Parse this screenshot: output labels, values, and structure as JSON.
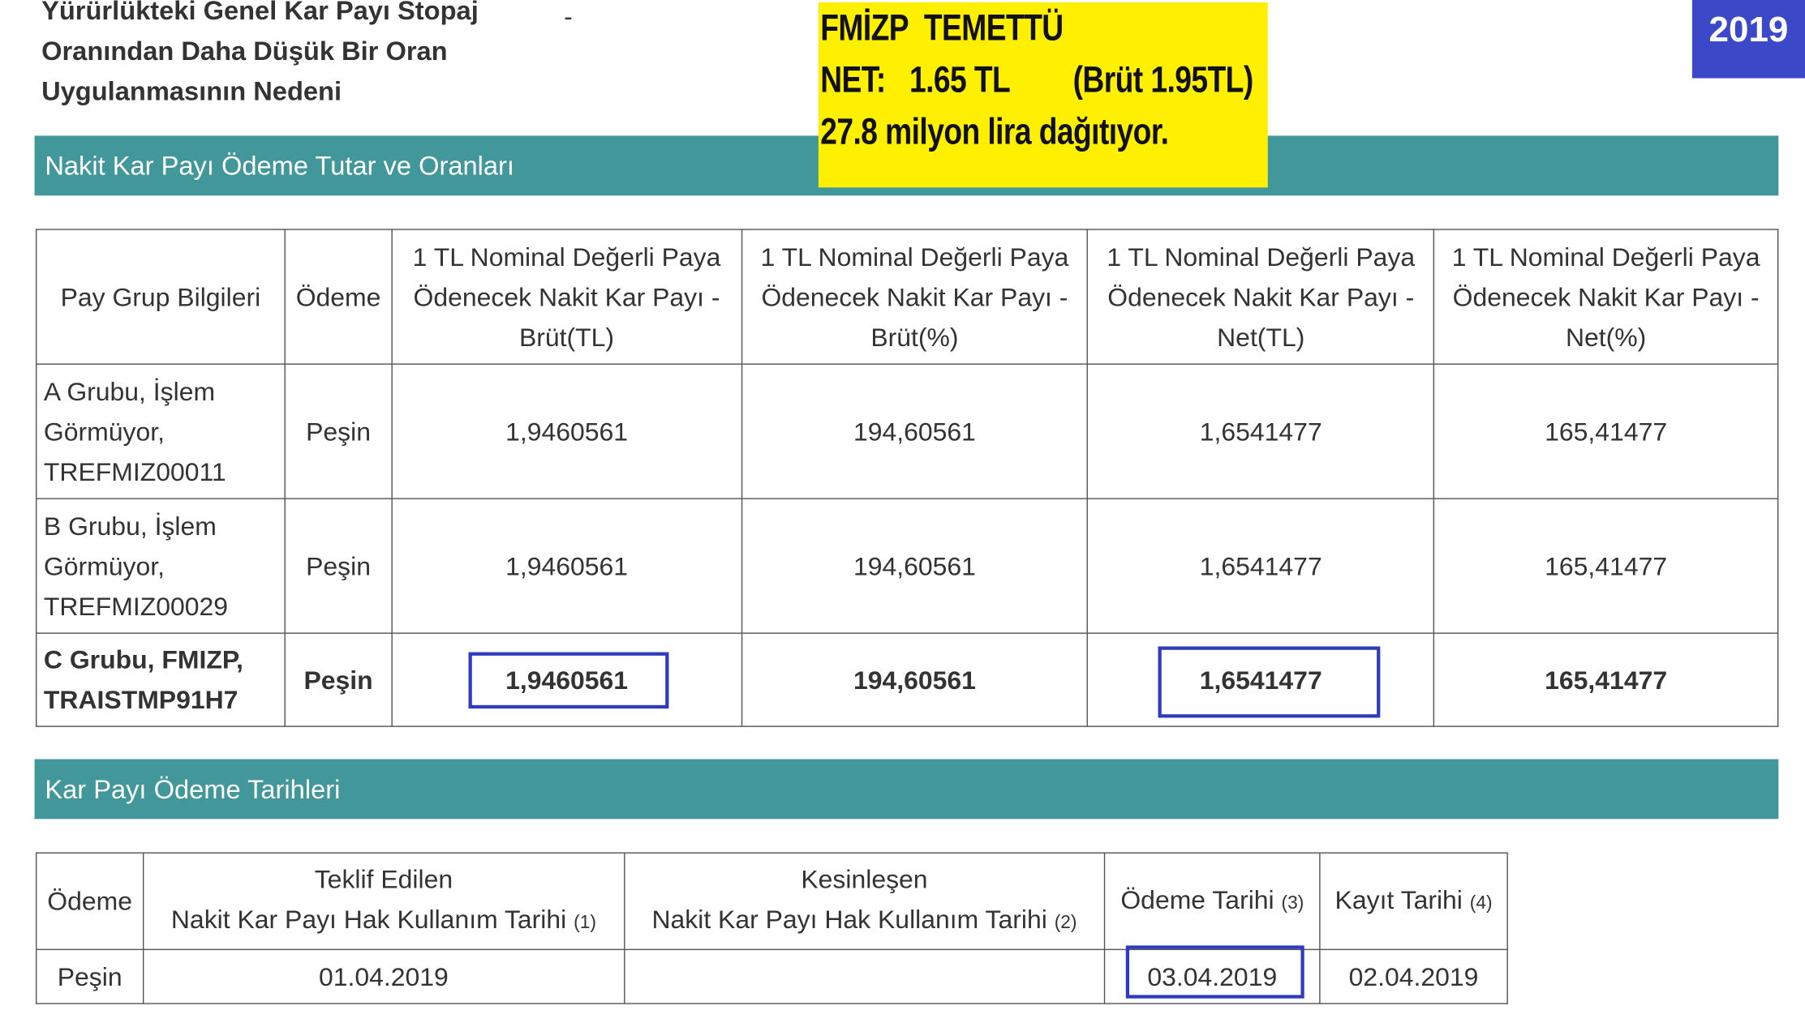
{
  "intro": {
    "lines": [
      "Yürürlükteki Genel Kar Payı Stopaj",
      "Oranından Daha Düşük Bir Oran",
      "Uygulanmasının Nedeni"
    ],
    "value": "-"
  },
  "highlight": {
    "line1": "FMİZP  TEMETTÜ",
    "line2": "NET:   1.65 TL        (Brüt 1.95TL)",
    "line3": "27.8 milyon lira dağıtıyor."
  },
  "year_badge": "2019",
  "section1": {
    "title": "Nakit Kar Payı Ödeme Tutar ve Oranları"
  },
  "payment_table": {
    "headers": [
      "Pay Grup Bilgileri",
      "Ödeme",
      "1 TL Nominal Değerli Paya Ödenecek Nakit Kar Payı - Brüt(TL)",
      "1 TL Nominal Değerli Paya Ödenecek Nakit Kar Payı - Brüt(%)",
      "1 TL Nominal Değerli Paya Ödenecek Nakit Kar Payı - Net(TL)",
      "1 TL Nominal Değerli Paya Ödenecek Nakit Kar Payı - Net(%)"
    ],
    "rows": [
      {
        "group": "A Grubu, İşlem Görmüyor, TREFMIZ00011",
        "payment": "Peşin",
        "gross_tl": "1,9460561",
        "gross_pct": "194,60561",
        "net_tl": "1,6541477",
        "net_pct": "165,41477"
      },
      {
        "group": "B Grubu, İşlem Görmüyor, TREFMIZ00029",
        "payment": "Peşin",
        "gross_tl": "1,9460561",
        "gross_pct": "194,60561",
        "net_tl": "1,6541477",
        "net_pct": "165,41477"
      },
      {
        "group": "C Grubu, FMIZP, TRAISTMP91H7",
        "payment": "Peşin",
        "gross_tl": "1,9460561",
        "gross_pct": "194,60561",
        "net_tl": "1,6541477",
        "net_pct": "165,41477"
      }
    ]
  },
  "section2": {
    "title": "Kar Payı Ödeme Tarihleri"
  },
  "dates_table": {
    "h_payment": "Ödeme",
    "h_proposed_1": "Teklif Edilen",
    "h_proposed_2": "Nakit Kar Payı Hak Kullanım Tarihi",
    "h_proposed_note": "(1)",
    "h_final_1": "Kesinleşen",
    "h_final_2": "Nakit Kar Payı Hak Kullanım Tarihi",
    "h_final_note": "(2)",
    "h_paydate": "Ödeme Tarihi",
    "h_paydate_note": "(3)",
    "h_record": "Kayıt Tarihi",
    "h_record_note": "(4)",
    "row": {
      "payment": "Peşin",
      "proposed": "01.04.2019",
      "final": "",
      "paydate": "03.04.2019",
      "record": "02.04.2019"
    }
  },
  "colors": {
    "section_bar": "#41979a",
    "highlight_bg": "#ffef00",
    "badge_bg": "#3b48c8",
    "marker": "#2f3bbf"
  }
}
